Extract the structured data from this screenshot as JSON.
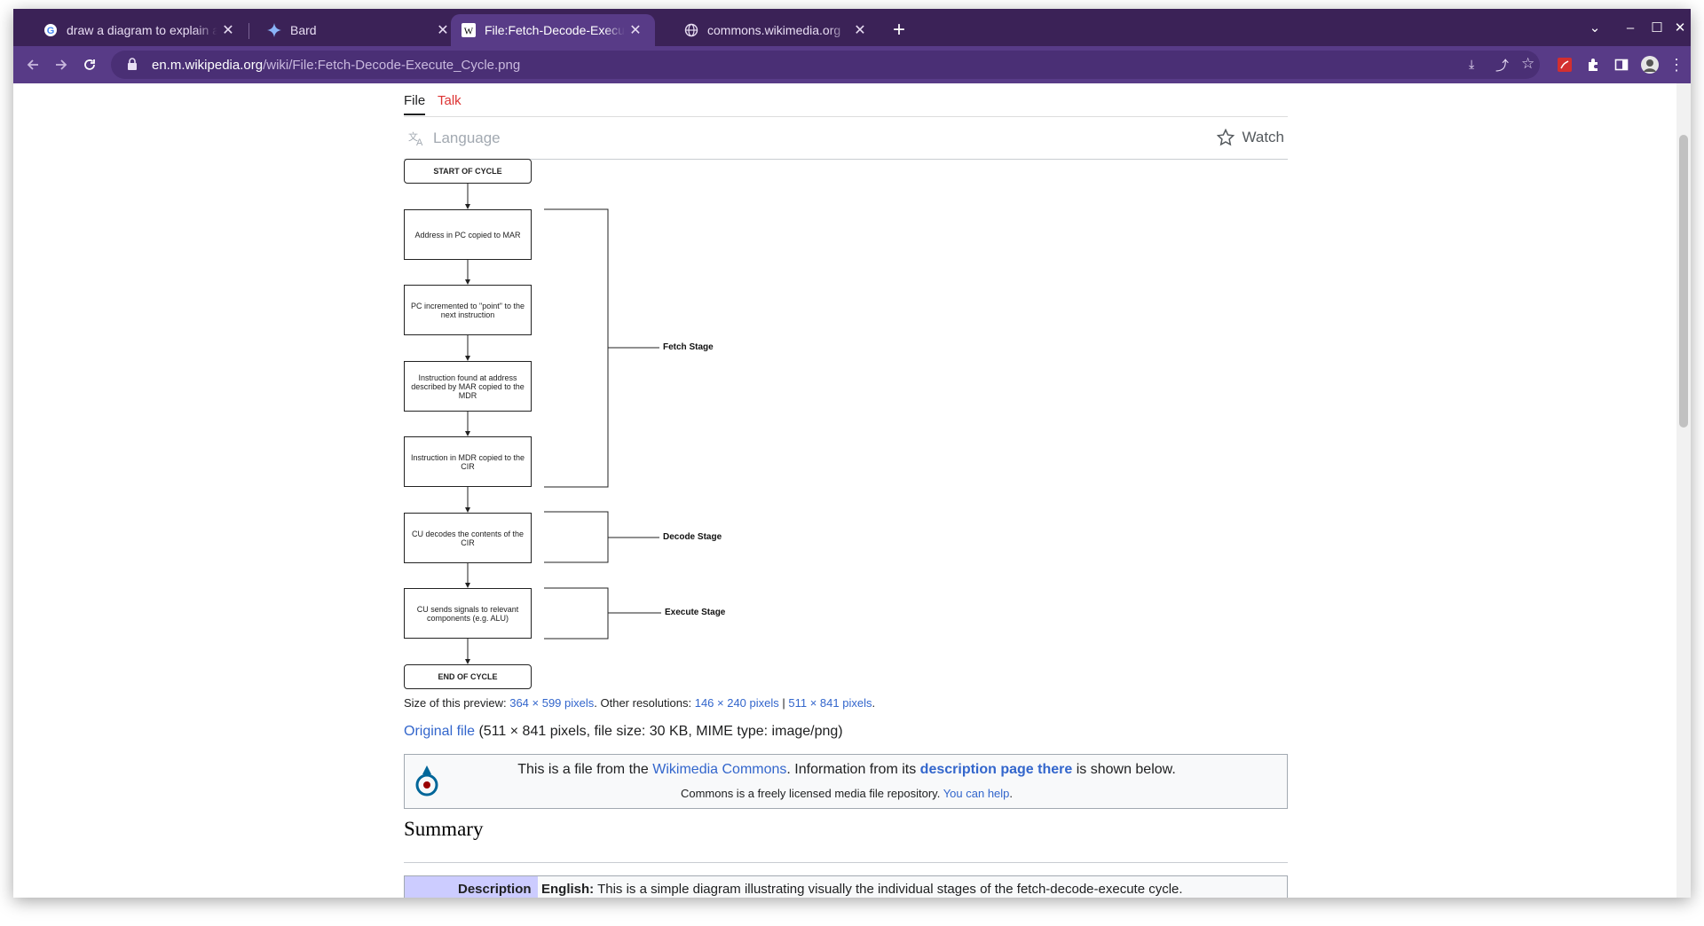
{
  "browser": {
    "tabs": [
      {
        "title": "draw a diagram to explain a",
        "favicon": "google-icon",
        "active": false
      },
      {
        "title": "Bard",
        "favicon": "bard-sparkle-icon",
        "active": false
      },
      {
        "title": "File:Fetch-Decode-Execute C",
        "favicon": "wikipedia-icon",
        "active": true
      },
      {
        "title": "commons.wikimedia.org",
        "favicon": "globe-icon",
        "active": false
      }
    ],
    "url_host": "en.m.wikipedia.org",
    "url_path": "/wiki/File:Fetch-Decode-Execute_Cycle.png",
    "accent": "#583b87",
    "tabstrip_color": "#3b2257"
  },
  "page": {
    "tabs": {
      "file": "File",
      "talk": "Talk"
    },
    "language": "Language",
    "watch": "Watch",
    "diagram": {
      "start": "START OF CYCLE",
      "steps": [
        "Address in PC copied to MAR",
        "PC incremented to \"point\" to the next instruction",
        "Instruction found at address described by MAR copied to the MDR",
        "Instruction in MDR copied to the CIR",
        "CU decodes the contents of the CIR",
        "CU sends signals to relevant components (e.g. ALU)"
      ],
      "end": "END OF CYCLE",
      "stages": {
        "fetch": "Fetch Stage",
        "decode": "Decode Stage",
        "execute": "Execute Stage"
      }
    },
    "preview": {
      "prefix": "Size of this preview: ",
      "size_link": "364 × 599 pixels",
      "other": ". Other resolutions: ",
      "res1": "146 × 240 pixels",
      "sep": " | ",
      "res2": "511 × 841 pixels",
      "end": "."
    },
    "original": {
      "link": "Original file",
      "details": " (511 × 841 pixels, file size: 30 KB, MIME type: image/png)"
    },
    "commons": {
      "l1_a": "This is a file from the ",
      "l1_link": "Wikimedia Commons",
      "l1_b": ". Information from its ",
      "l1_link2": "description page there",
      "l1_c": " is shown below.",
      "l2_a": "Commons is a freely licensed media file repository. ",
      "l2_link": "You can help",
      "l2_b": "."
    },
    "summary_heading": "Summary",
    "description": {
      "header": "Description",
      "lang": "English:",
      "text": " This is a simple diagram illustrating visually the individual stages of the fetch-decode-execute cycle."
    }
  }
}
